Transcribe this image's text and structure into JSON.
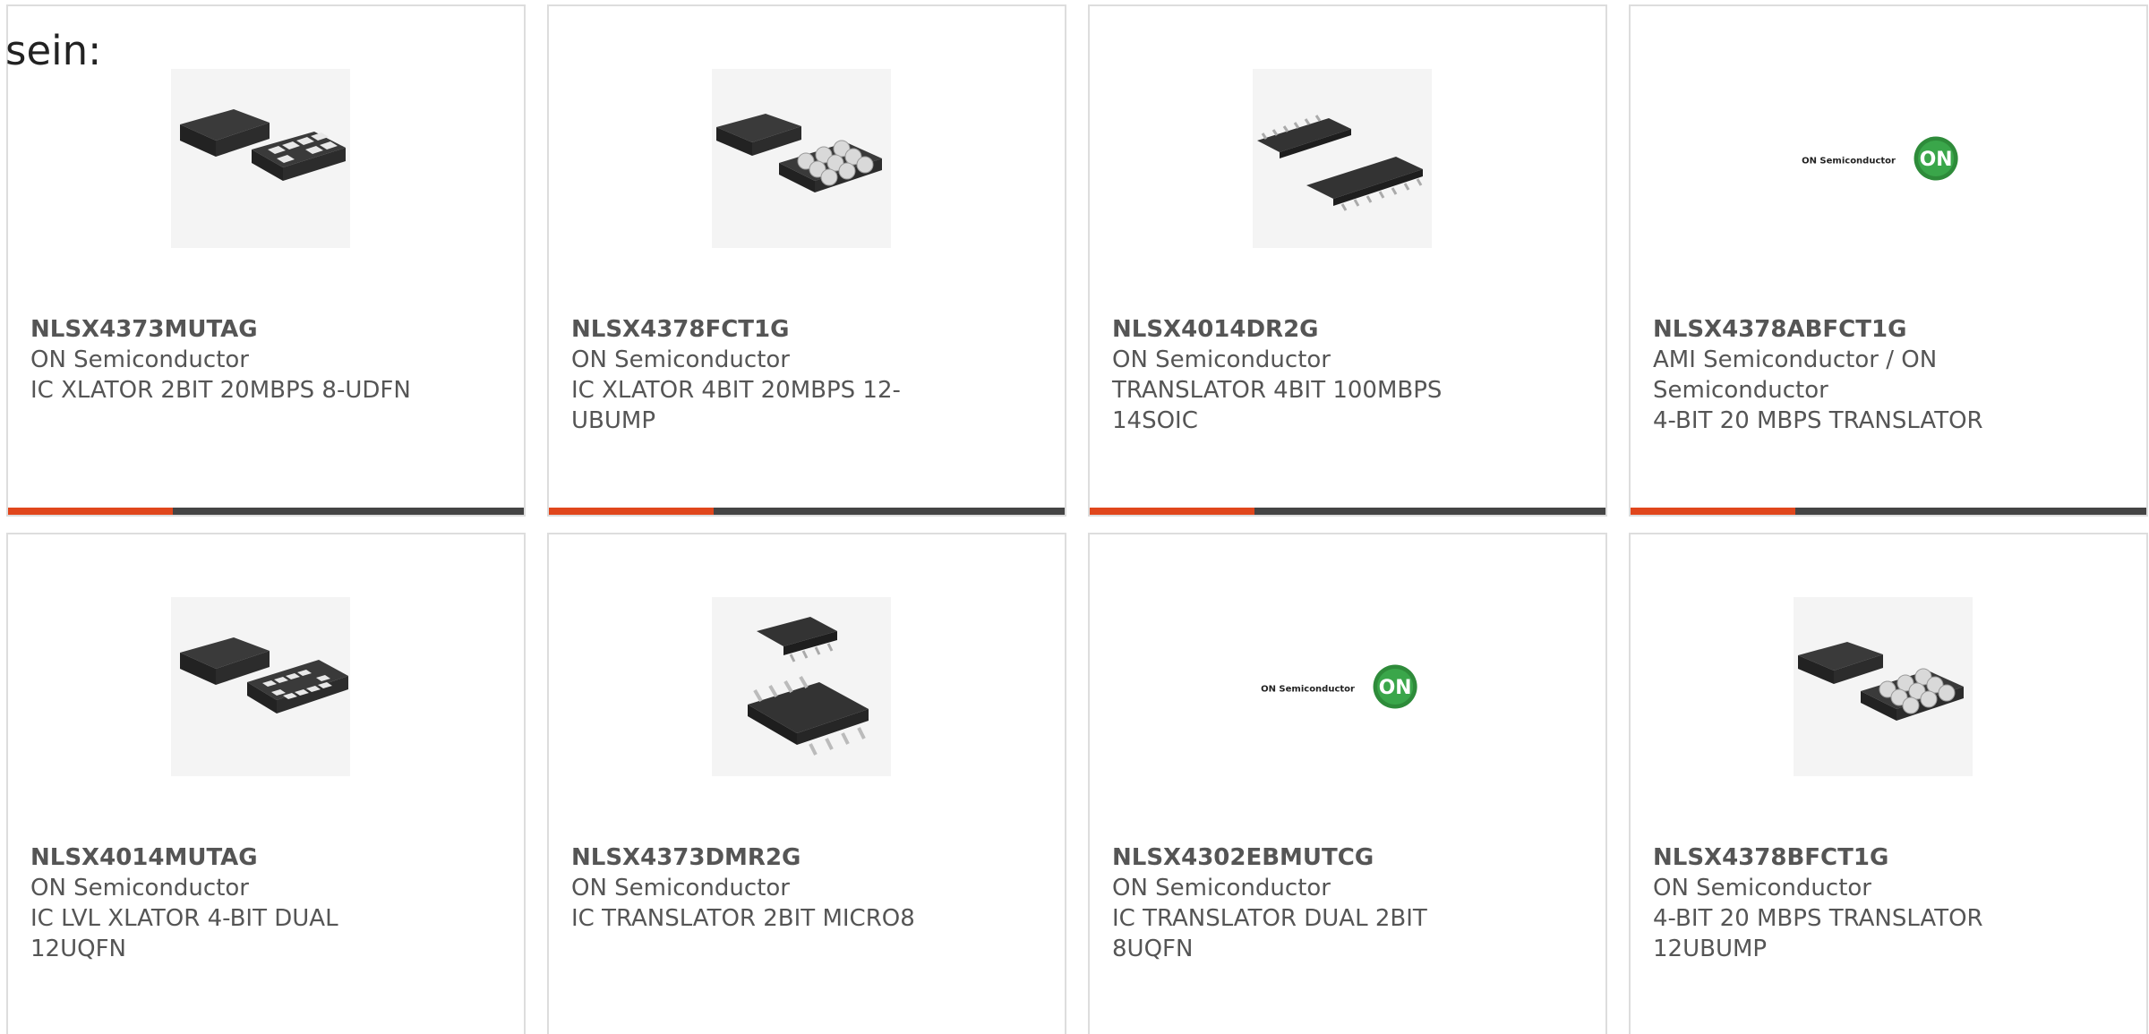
{
  "intro_text": "sein:",
  "colors": {
    "accent": "#e0461c",
    "bar": "#444444",
    "border": "#dddddd",
    "text": "#555555"
  },
  "products": [
    {
      "part": "NLSX4373MUTAG",
      "manufacturer": "ON Semiconductor",
      "description": "IC XLATOR 2BIT 20MBPS 8-UDFN",
      "image": "udfn-package-icon"
    },
    {
      "part": "NLSX4378FCT1G",
      "manufacturer": "ON Semiconductor",
      "description": "IC XLATOR 4BIT 20MBPS 12-UBUMP",
      "image": "ubump-package-icon"
    },
    {
      "part": "NLSX4014DR2G",
      "manufacturer": "ON Semiconductor",
      "description": "TRANSLATOR 4BIT 100MBPS 14SOIC",
      "image": "soic-package-icon"
    },
    {
      "part": "NLSX4378ABFCT1G",
      "manufacturer": "AMI Semiconductor / ON Semiconductor",
      "description": "4-BIT 20 MBPS TRANSLATOR",
      "image": "on-semiconductor-logo",
      "logo_text": "ON Semiconductor",
      "logo_badge": "ON"
    },
    {
      "part": "NLSX4014MUTAG",
      "manufacturer": "ON Semiconductor",
      "description": "IC LVL XLATOR 4-BIT DUAL 12UQFN",
      "image": "uqfn-package-icon"
    },
    {
      "part": "NLSX4373DMR2G",
      "manufacturer": "ON Semiconductor",
      "description": "IC TRANSLATOR 2BIT MICRO8",
      "image": "micro8-package-icon"
    },
    {
      "part": "NLSX4302EBMUTCG",
      "manufacturer": "ON Semiconductor",
      "description": "IC TRANSLATOR DUAL 2BIT 8UQFN",
      "image": "on-semiconductor-logo",
      "logo_text": "ON Semiconductor",
      "logo_badge": "ON"
    },
    {
      "part": "NLSX4378BFCT1G",
      "manufacturer": "ON Semiconductor",
      "description": "4-BIT 20 MBPS TRANSLATOR 12UBUMP",
      "image": "ubump-package-icon"
    }
  ]
}
